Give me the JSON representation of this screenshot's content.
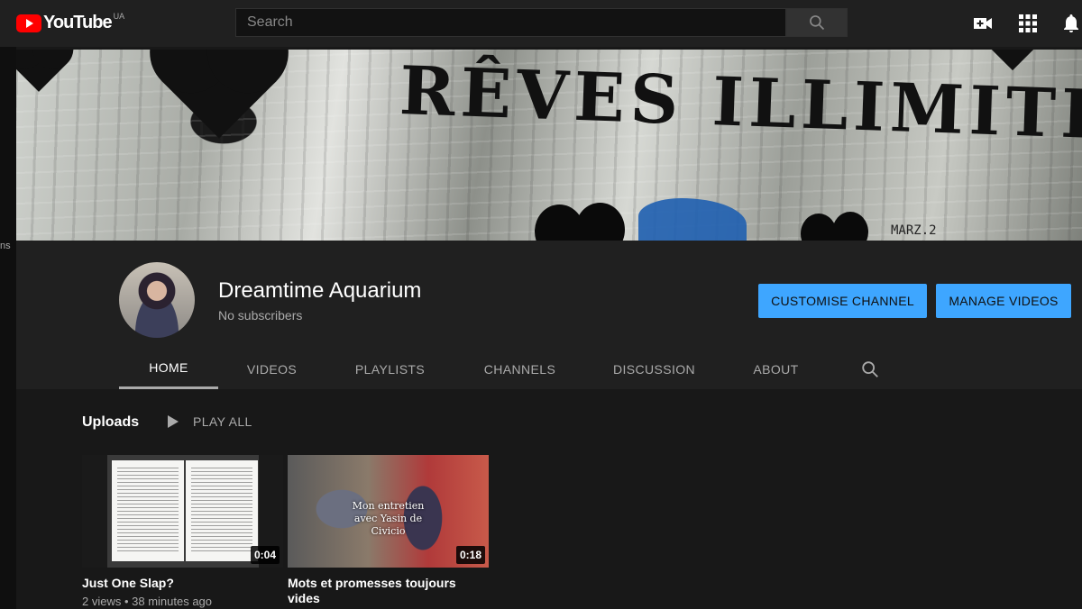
{
  "masthead": {
    "logo_text": "YouTube",
    "region": "UA",
    "search_placeholder": "Search"
  },
  "banner": {
    "text": "RÊVES ILLIMITÉS",
    "signature": "MARZ.2"
  },
  "side_text": "ns",
  "channel": {
    "name": "Dreamtime Aquarium",
    "subscribers": "No subscribers",
    "customise_label": "CUSTOMISE CHANNEL",
    "manage_label": "MANAGE VIDEOS"
  },
  "tabs": [
    {
      "label": "HOME",
      "active": true
    },
    {
      "label": "VIDEOS",
      "active": false
    },
    {
      "label": "PLAYLISTS",
      "active": false
    },
    {
      "label": "CHANNELS",
      "active": false
    },
    {
      "label": "DISCUSSION",
      "active": false
    },
    {
      "label": "ABOUT",
      "active": false
    }
  ],
  "uploads": {
    "title": "Uploads",
    "play_all": "PLAY ALL",
    "videos": [
      {
        "title": "Just One Slap?",
        "duration": "0:04",
        "meta": "2 views • 38 minutes ago"
      },
      {
        "title": "Mots et promesses toujours vides",
        "duration": "0:18",
        "overlay": "Mon entretien avec Yasin de Civicio"
      }
    ]
  },
  "colors": {
    "accent_blue": "#3ea6ff",
    "youtube_red": "#ff0000",
    "header_bg": "#202020",
    "page_bg": "#181818"
  },
  "icons": [
    "search-icon",
    "create-video-icon",
    "apps-grid-icon",
    "notifications-bell-icon",
    "channel-search-icon",
    "play-icon"
  ]
}
